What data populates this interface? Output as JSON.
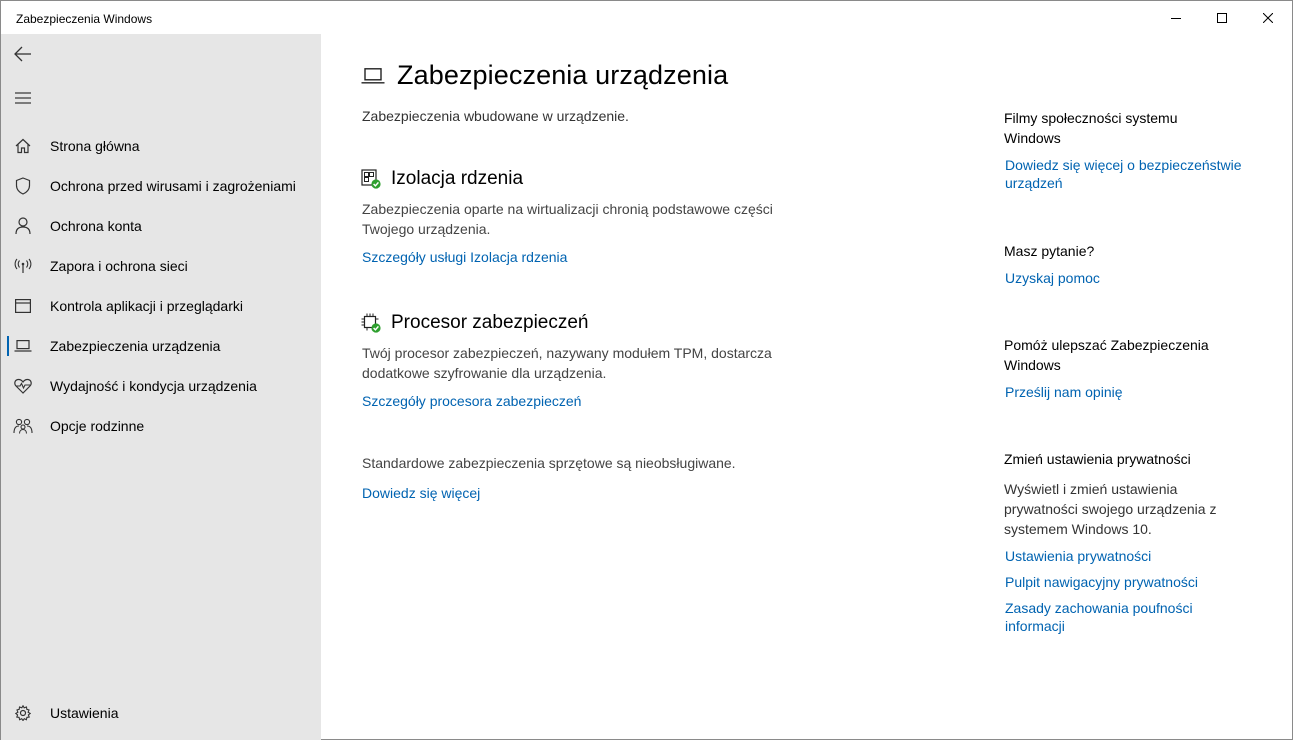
{
  "window": {
    "title": "Zabezpieczenia Windows"
  },
  "sidebar": {
    "items": [
      {
        "label": "Strona główna",
        "icon": "home-icon"
      },
      {
        "label": "Ochrona przed wirusami i zagrożeniami",
        "icon": "shield-icon"
      },
      {
        "label": "Ochrona konta",
        "icon": "person-icon"
      },
      {
        "label": "Zapora i ochrona sieci",
        "icon": "antenna-icon"
      },
      {
        "label": "Kontrola aplikacji i przeglądarki",
        "icon": "browser-window-icon"
      },
      {
        "label": "Zabezpieczenia urządzenia",
        "icon": "laptop-icon",
        "active": true
      },
      {
        "label": "Wydajność i kondycja urządzenia",
        "icon": "heart-pulse-icon"
      },
      {
        "label": "Opcje rodzinne",
        "icon": "family-icon"
      }
    ],
    "settings_label": "Ustawienia"
  },
  "main": {
    "title": "Zabezpieczenia urządzenia",
    "subtitle": "Zabezpieczenia wbudowane w urządzenie.",
    "sections": [
      {
        "title": "Izolacja rdzenia",
        "desc_line1": "Zabezpieczenia oparte na wirtualizacji chronią podstawowe części",
        "desc_line2": "Twojego urządzenia.",
        "link": "Szczegóły usługi Izolacja rdzenia"
      },
      {
        "title": "Procesor zabezpieczeń",
        "desc_line1": "Twój procesor zabezpieczeń, nazywany modułem TPM, dostarcza",
        "desc_line2": "dodatkowe szyfrowanie dla urządzenia.",
        "link": "Szczegóły procesora zabezpieczeń"
      }
    ],
    "hardware_note": "Standardowe zabezpieczenia sprzętowe są nieobsługiwane.",
    "hardware_link": "Dowiedz się więcej"
  },
  "aside": {
    "community": {
      "heading_line1": "Filmy społeczności systemu",
      "heading_line2": "Windows",
      "link_line1": "Dowiedz się więcej o bezpieczeństwie",
      "link_line2": "urządzeń"
    },
    "question": {
      "heading": "Masz pytanie?",
      "link": "Uzyskaj pomoc"
    },
    "improve": {
      "heading_line1": "Pomóż ulepszać Zabezpieczenia",
      "heading_line2": "Windows",
      "link": "Prześlij nam opinię"
    },
    "privacy": {
      "heading": "Zmień ustawienia prywatności",
      "desc_line1": "Wyświetl i zmień ustawienia",
      "desc_line2": "prywatności swojego urządzenia z",
      "desc_line3": "systemem Windows 10.",
      "link1": "Ustawienia prywatności",
      "link2": "Pulpit nawigacyjny prywatności",
      "link3_line1": "Zasady zachowania poufności",
      "link3_line2": "informacji"
    }
  },
  "colors": {
    "accent": "#0063b1",
    "sidebar_bg": "#e6e6e6",
    "status_ok": "#2e9f2e"
  }
}
